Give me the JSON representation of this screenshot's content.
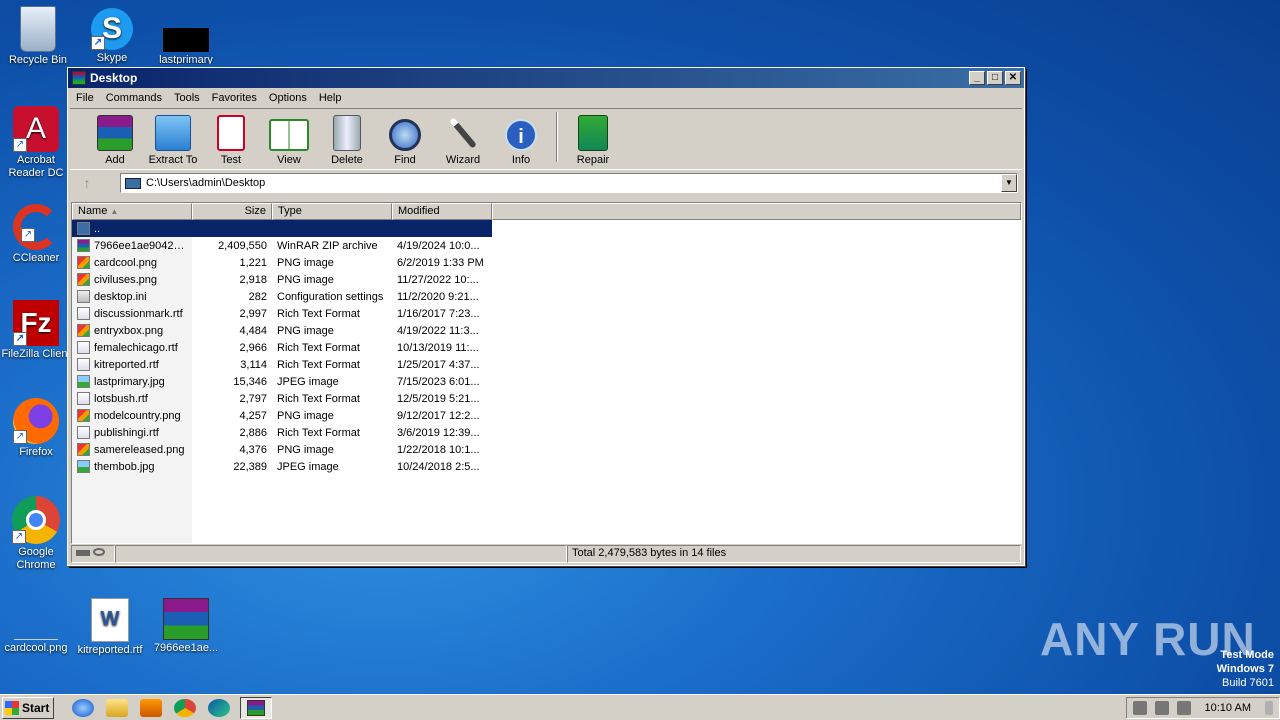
{
  "desktop": {
    "icons": [
      {
        "label": "Recycle Bin"
      },
      {
        "label": "Skype"
      },
      {
        "label": "lastprimary"
      },
      {
        "label": "Acrobat Reader DC"
      },
      {
        "label": "CCleaner"
      },
      {
        "label": "FileZilla Client"
      },
      {
        "label": "Firefox"
      },
      {
        "label": "Google Chrome"
      },
      {
        "label": "cardcool.png"
      },
      {
        "label": "kitreported.rtf"
      },
      {
        "label": "7966ee1ae..."
      }
    ],
    "watermark": "ANY RUN",
    "test_mode": {
      "line1": "Test Mode",
      "line2": "Windows 7",
      "line3": "Build 7601"
    }
  },
  "window": {
    "title": "Desktop",
    "buttons": {
      "min": "_",
      "max": "□",
      "close": "✕"
    },
    "menu": [
      "File",
      "Commands",
      "Tools",
      "Favorites",
      "Options",
      "Help"
    ],
    "toolbar": [
      {
        "label": "Add",
        "icon": "add-archive-icon"
      },
      {
        "label": "Extract To",
        "icon": "extract-folder-icon"
      },
      {
        "label": "Test",
        "icon": "test-clipboard-icon"
      },
      {
        "label": "View",
        "icon": "view-book-icon"
      },
      {
        "label": "Delete",
        "icon": "trash-icon"
      },
      {
        "label": "Find",
        "icon": "magnifier-icon"
      },
      {
        "label": "Wizard",
        "icon": "wand-icon"
      },
      {
        "label": "Info",
        "icon": "info-icon"
      },
      {
        "label": "Repair",
        "icon": "repair-icon"
      }
    ],
    "address": "C:\\Users\\admin\\Desktop",
    "columns": {
      "name": "Name",
      "size": "Size",
      "type": "Type",
      "modified": "Modified"
    },
    "files": [
      {
        "name": "..",
        "size": "",
        "type": "",
        "modified": ""
      },
      {
        "name": "7966ee1ae9042e...",
        "size": "2,409,550",
        "type": "WinRAR ZIP archive",
        "modified": "4/19/2024 10:0..."
      },
      {
        "name": "cardcool.png",
        "size": "1,221",
        "type": "PNG image",
        "modified": "6/2/2019 1:33 PM"
      },
      {
        "name": "civiluses.png",
        "size": "2,918",
        "type": "PNG image",
        "modified": "11/27/2022 10:..."
      },
      {
        "name": "desktop.ini",
        "size": "282",
        "type": "Configuration settings",
        "modified": "11/2/2020 9:21..."
      },
      {
        "name": "discussionmark.rtf",
        "size": "2,997",
        "type": "Rich Text Format",
        "modified": "1/16/2017 7:23..."
      },
      {
        "name": "entryxbox.png",
        "size": "4,484",
        "type": "PNG image",
        "modified": "4/19/2022 11:3..."
      },
      {
        "name": "femalechicago.rtf",
        "size": "2,966",
        "type": "Rich Text Format",
        "modified": "10/13/2019 11:..."
      },
      {
        "name": "kitreported.rtf",
        "size": "3,114",
        "type": "Rich Text Format",
        "modified": "1/25/2017 4:37..."
      },
      {
        "name": "lastprimary.jpg",
        "size": "15,346",
        "type": "JPEG image",
        "modified": "7/15/2023 6:01..."
      },
      {
        "name": "lotsbush.rtf",
        "size": "2,797",
        "type": "Rich Text Format",
        "modified": "12/5/2019 5:21..."
      },
      {
        "name": "modelcountry.png",
        "size": "4,257",
        "type": "PNG image",
        "modified": "9/12/2017 12:2..."
      },
      {
        "name": "publishingi.rtf",
        "size": "2,886",
        "type": "Rich Text Format",
        "modified": "3/6/2019 12:39..."
      },
      {
        "name": "samereleased.png",
        "size": "4,376",
        "type": "PNG image",
        "modified": "1/22/2018 10:1..."
      },
      {
        "name": "thembob.jpg",
        "size": "22,389",
        "type": "JPEG image",
        "modified": "10/24/2018 2:5..."
      }
    ],
    "status": "Total 2,479,583 bytes in 14 files"
  },
  "taskbar": {
    "start": "Start",
    "clock": "10:10 AM"
  }
}
